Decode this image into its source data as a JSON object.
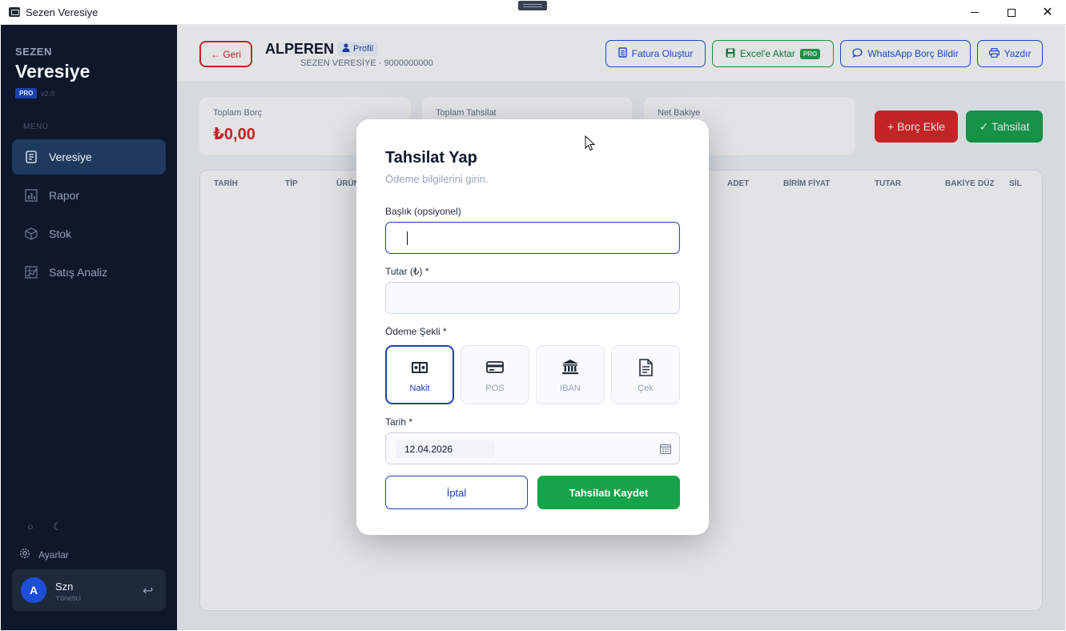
{
  "window": {
    "title": "Sezen Veresiye"
  },
  "sidebar": {
    "brand_top": "SEZEN",
    "brand_main": "Veresiye",
    "badge": "PRO",
    "version": "v2.0",
    "menu_caption": "MENÜ",
    "items": [
      {
        "label": "Veresiye",
        "icon": "ledger-icon",
        "active": true
      },
      {
        "label": "Rapor",
        "icon": "bar-chart-icon",
        "active": false
      },
      {
        "label": "Stok",
        "icon": "box-icon",
        "active": false
      },
      {
        "label": "Satış Analiz",
        "icon": "analytics-icon",
        "active": false
      }
    ],
    "theme_light": "○",
    "theme_dark": "☾",
    "settings_label": "Ayarlar",
    "user": {
      "initial": "A",
      "name": "Szn",
      "role": "Yönetici"
    }
  },
  "header": {
    "back_label": "← Geri",
    "customer_name": "ALPEREN",
    "profile_label": "Profil",
    "customer_sub": "SEZEN VERESİYE  ·  9000000000",
    "invoice_label": "Fatura Oluştur",
    "excel_label": "Excel'e Aktar",
    "excel_badge": "PRO",
    "whatsapp_label": "WhatsApp Borç Bildir",
    "print_label": "Yazdır"
  },
  "stats": {
    "total_debt_label": "Toplam Borç",
    "total_debt_value": "₺0,00",
    "total_collection_label": "Toplam Tahsilat",
    "net_balance_label": "Net Bakiye"
  },
  "actions": {
    "add_debt": "+ Borç Ekle",
    "collect": "✓ Tahsilat"
  },
  "table": {
    "headers": [
      "TARİH",
      "TİP",
      "ÜRÜN",
      "ADET",
      "BİRİM FİYAT",
      "TUTAR",
      "BAKİYE",
      "DÜZ",
      "SİL"
    ]
  },
  "modal": {
    "title": "Tahsilat Yap",
    "subtitle": "Ödeme bilgilerini girin.",
    "title_field_label": "Başlık (opsiyonel)",
    "title_field_value": "",
    "amount_label": "Tutar (₺) *",
    "amount_value": "",
    "payment_label": "Ödeme Şekli *",
    "payment_options": [
      {
        "label": "Nakit",
        "icon": "cash-icon",
        "selected": true
      },
      {
        "label": "POS",
        "icon": "credit-card-icon",
        "selected": false
      },
      {
        "label": "IBAN",
        "icon": "bank-icon",
        "selected": false
      },
      {
        "label": "Çek",
        "icon": "cheque-icon",
        "selected": false
      }
    ],
    "date_label": "Tarih *",
    "date_value": "12.04.2026",
    "cancel_label": "İptal",
    "save_label": "Tahsilatı Kaydet"
  }
}
